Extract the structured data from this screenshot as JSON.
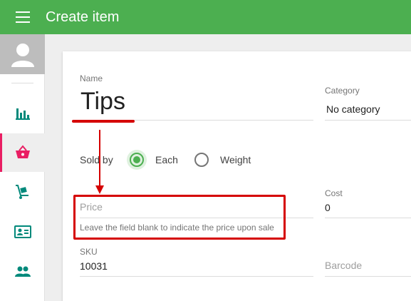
{
  "header": {
    "title": "Create item"
  },
  "sidebar": {
    "items": [
      {
        "name": "reports",
        "icon": "bar-chart-icon"
      },
      {
        "name": "items",
        "icon": "basket-icon",
        "active": true
      },
      {
        "name": "inventory",
        "icon": "hand-truck-icon"
      },
      {
        "name": "customers",
        "icon": "id-card-icon"
      },
      {
        "name": "employees",
        "icon": "people-icon"
      }
    ]
  },
  "form": {
    "name": {
      "label": "Name",
      "value": "Tips"
    },
    "category": {
      "label": "Category",
      "value": "No category"
    },
    "sold_by": {
      "label": "Sold by",
      "options": [
        "Each",
        "Weight"
      ],
      "selected": "Each"
    },
    "price": {
      "placeholder": "Price",
      "hint": "Leave the field blank to indicate the price upon sale"
    },
    "cost": {
      "label": "Cost",
      "value": "0"
    },
    "sku": {
      "label": "SKU",
      "value": "10031"
    },
    "barcode": {
      "placeholder": "Barcode"
    }
  },
  "colors": {
    "primary": "#4caf50",
    "active_indicator": "#e91e63",
    "annotation": "#d50000",
    "sidebar_icon": "#00897b"
  }
}
